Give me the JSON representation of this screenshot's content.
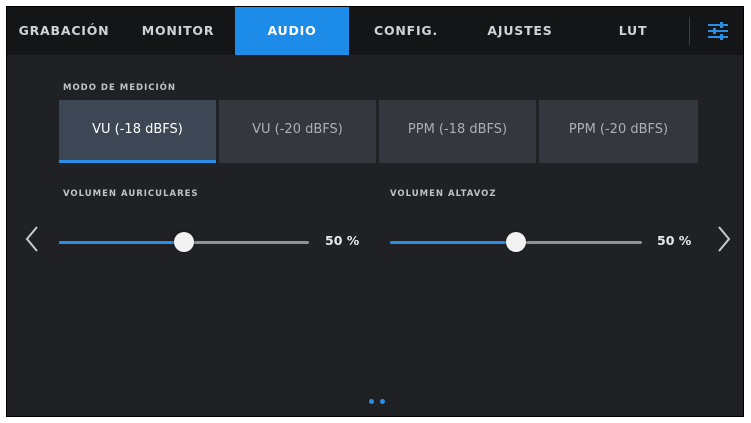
{
  "tabs": [
    {
      "label": "GRABACIÓN",
      "active": false
    },
    {
      "label": "MONITOR",
      "active": false
    },
    {
      "label": "AUDIO",
      "active": true
    },
    {
      "label": "CONFIG.",
      "active": false
    },
    {
      "label": "AJUSTES",
      "active": false
    },
    {
      "label": "LUT",
      "active": false
    }
  ],
  "menu_icon": "settings-sliders-icon",
  "metering": {
    "label": "MODO DE MEDICIÓN",
    "options": [
      "VU (-18 dBFS)",
      "VU (-20 dBFS)",
      "PPM (-18 dBFS)",
      "PPM (-20 dBFS)"
    ],
    "selected": "VU (-18 dBFS)"
  },
  "headphones": {
    "label": "VOLUMEN AURICULARES",
    "value": 50,
    "value_text": "50 %"
  },
  "speaker": {
    "label": "VOLUMEN ALTAVOZ",
    "value": 50,
    "value_text": "50 %"
  },
  "nav": {
    "prev_icon": "chevron-left-icon",
    "next_icon": "chevron-right-icon"
  },
  "pagination": {
    "pages": 2,
    "current": 1
  },
  "colors": {
    "accent": "#2a8de6",
    "active_tab": "#1c8ce8",
    "background": "#1f2125",
    "tabbar": "#141517"
  }
}
